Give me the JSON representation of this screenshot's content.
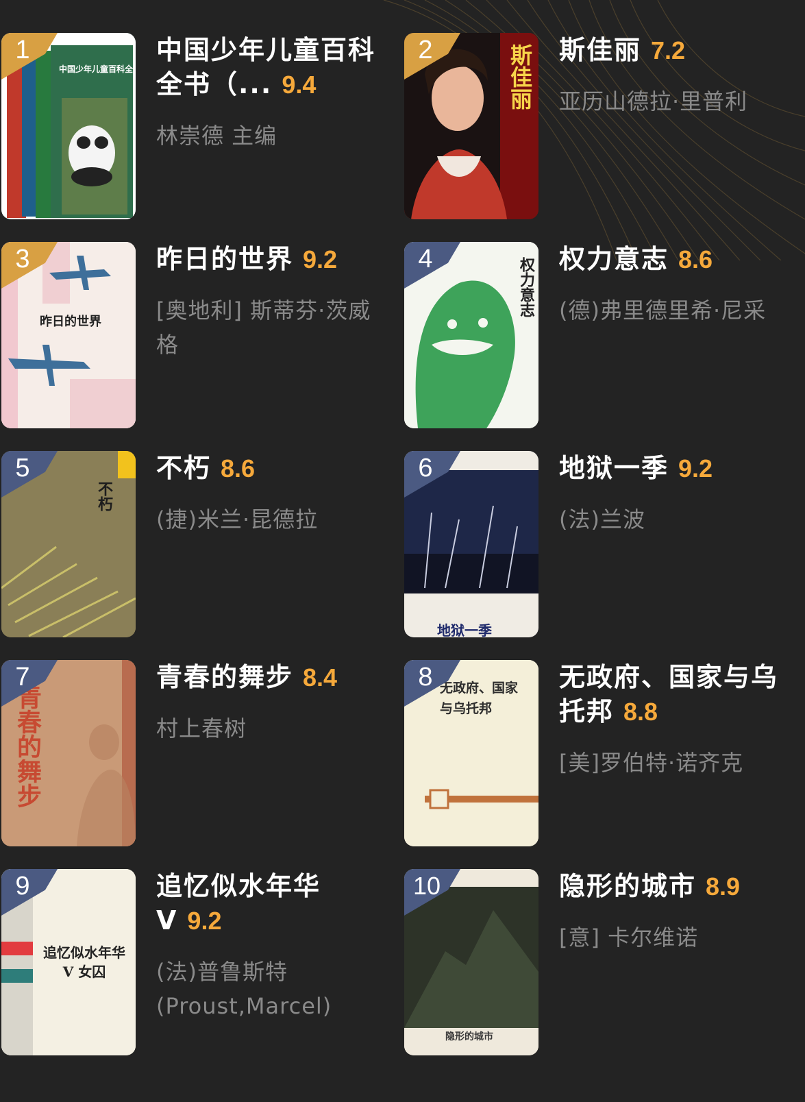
{
  "books": [
    {
      "rank": "1",
      "title": "中国少年儿童百科全书（...",
      "rating": "9.4",
      "author": "林崇德 主编",
      "cover": {
        "bg": "#2f6e4c",
        "badge": "#d8a043",
        "title": "中国少年儿童百科全书"
      }
    },
    {
      "rank": "2",
      "title": "斯佳丽",
      "rating": "7.2",
      "author": "亚历山德拉·里普利",
      "cover": {
        "bg": "#c0392b",
        "badge": "#d8a043",
        "title": "斯佳丽"
      }
    },
    {
      "rank": "3",
      "title": "昨日的世界",
      "rating": "9.2",
      "author": "[奥地利] 斯蒂芬·茨威格",
      "cover": {
        "bg": "#f3ece4",
        "badge": "#d8a043",
        "title": "昨日的世界"
      }
    },
    {
      "rank": "4",
      "title": "权力意志",
      "rating": "8.6",
      "author": "(德)弗里德里希·尼采",
      "cover": {
        "bg": "#eef3e6",
        "badge": "#4b5a82",
        "title": "权力意志"
      }
    },
    {
      "rank": "5",
      "title": "不朽",
      "rating": "8.6",
      "author": "(捷)米兰·昆德拉",
      "cover": {
        "bg": "#8a7d55",
        "badge": "#4b5a82",
        "title": "不朽"
      }
    },
    {
      "rank": "6",
      "title": "地狱一季",
      "rating": "9.2",
      "author": "(法)兰波",
      "cover": {
        "bg": "#1f2546",
        "badge": "#4b5a82",
        "title": "地狱一季"
      }
    },
    {
      "rank": "7",
      "title": "青春的舞步",
      "rating": "8.4",
      "author": "村上春树",
      "cover": {
        "bg": "#c89a78",
        "badge": "#4b5a82",
        "title": "青春的舞步"
      }
    },
    {
      "rank": "8",
      "title": "无政府、国家与乌托邦",
      "rating": "8.8",
      "author": "[美]罗伯特·诺齐克",
      "cover": {
        "bg": "#f3eed8",
        "badge": "#4b5a82",
        "title": "无政府、国家与乌托邦"
      }
    },
    {
      "rank": "9",
      "title": "追忆似水年华 V",
      "rating": "9.2",
      "author": "(法)普鲁斯特 (Proust,Marcel)",
      "cover": {
        "bg": "#f1ecdf",
        "badge": "#4b5a82",
        "title": "追忆似水年华 V 女囚"
      }
    },
    {
      "rank": "10",
      "title": "隐形的城市",
      "rating": "8.9",
      "author": "[意] 卡尔维诺",
      "cover": {
        "bg": "#2c3326",
        "badge": "#4b5a82",
        "title": "隐形的城市"
      }
    }
  ]
}
